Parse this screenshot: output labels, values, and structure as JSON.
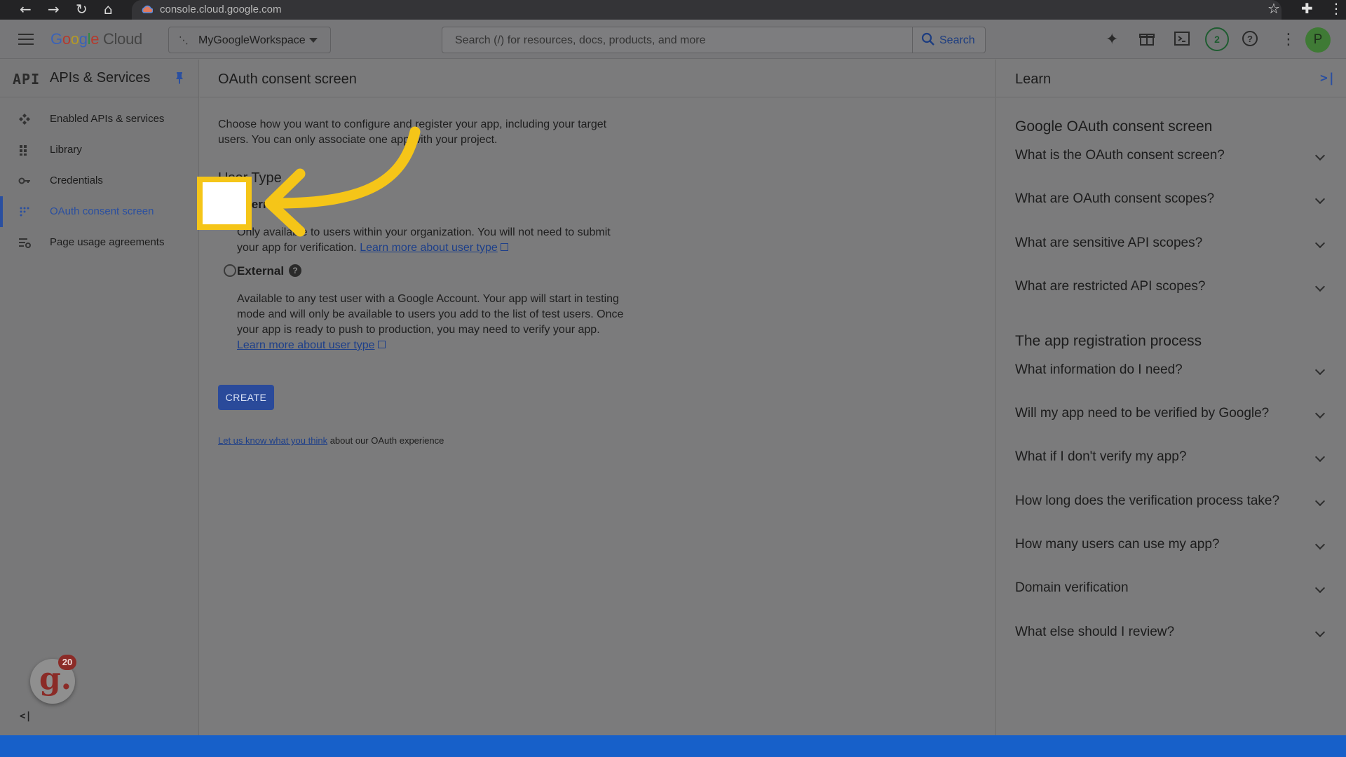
{
  "browser": {
    "url": "console.cloud.google.com",
    "back_icon": "←",
    "forward_icon": "→",
    "reload_icon": "↻",
    "home_icon": "⌂",
    "star_icon": "☆",
    "ext_icon": "✚",
    "menu_icon": "⋮"
  },
  "header": {
    "logo_google": [
      "G",
      "o",
      "o",
      "g",
      "l",
      "e"
    ],
    "logo_cloud": "Cloud",
    "project": "MyGoogleWorkspace",
    "search_placeholder": "Search (/) for resources, docs, products, and more",
    "search_button": "Search",
    "notification_count": "2",
    "avatar_letter": "P",
    "icons": {
      "gemini": "✦",
      "gift": "🎁",
      "terminal": "⌨",
      "help": "?",
      "more": "⋮"
    }
  },
  "sidebar": {
    "api_label": "API",
    "title": "APIs & Services",
    "items": [
      {
        "label": "Enabled APIs & services",
        "icon": "enabled-apis-icon"
      },
      {
        "label": "Library",
        "icon": "library-icon"
      },
      {
        "label": "Credentials",
        "icon": "key-icon"
      },
      {
        "label": "OAuth consent screen",
        "icon": "consent-icon",
        "active": true
      },
      {
        "label": "Page usage agreements",
        "icon": "agreements-icon"
      }
    ],
    "badge_letter": "g.",
    "badge_count": "20",
    "collapse_label": "<|"
  },
  "main": {
    "title": "OAuth consent screen",
    "intro": "Choose how you want to configure and register your app, including your target users. You can only associate one app with your project.",
    "user_type_heading": "User Type",
    "internal": {
      "label": "Internal",
      "selected": true,
      "desc": "Only available to users within your organization. You will not need to submit your app for verification.",
      "link": "Learn more about user type"
    },
    "external": {
      "label": "External",
      "selected": false,
      "desc": "Available to any test user with a Google Account. Your app will start in testing mode and will only be available to users you add to the list of test users. Once your app is ready to push to production, you may need to verify your app.",
      "link": "Learn more about user type"
    },
    "create_label": "CREATE",
    "feedback_link": "Let us know what you think",
    "feedback_rest": " about our OAuth experience"
  },
  "learn": {
    "title": "Learn",
    "section1": "Google OAuth consent screen",
    "section1_items": [
      "What is the OAuth consent screen?",
      "What are OAuth consent scopes?",
      "What are sensitive API scopes?",
      "What are restricted API scopes?"
    ],
    "section2": "The app registration process",
    "section2_items": [
      "What information do I need?",
      "Will my app need to be verified by Google?",
      "What if I don't verify my app?",
      "How long does the verification process take?",
      "How many users can use my app?",
      "Domain verification",
      "What else should I review?"
    ]
  },
  "colors": {
    "accent": "#2a4fa0",
    "annotation": "#f5c518",
    "bottom_bar": "#1760c9"
  }
}
